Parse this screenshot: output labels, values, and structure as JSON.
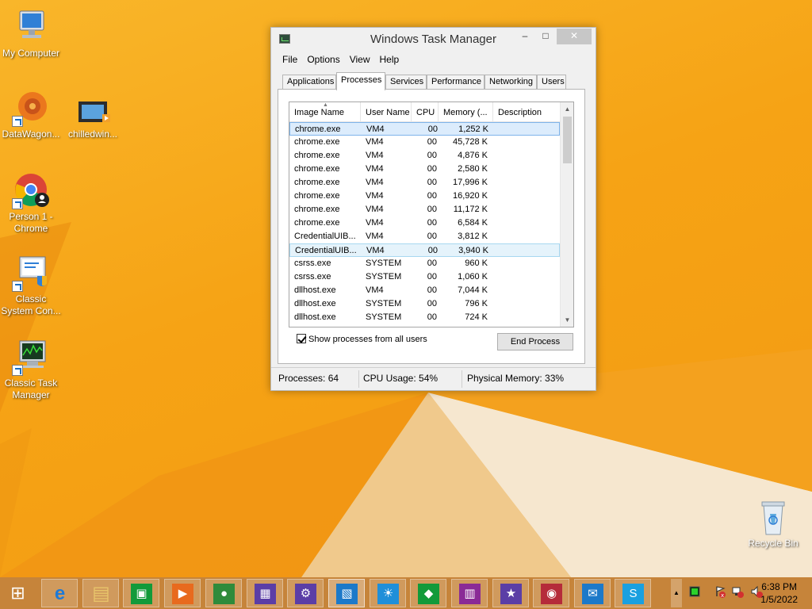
{
  "desktop": {
    "icons": [
      {
        "label": "My Computer",
        "icon": "monitor-icon"
      },
      {
        "label": "DataWagon...",
        "icon": "datawagon-icon"
      },
      {
        "label": "chilledwin...",
        "icon": "video-icon"
      },
      {
        "label": "Person 1 - Chrome",
        "icon": "chrome-icon"
      },
      {
        "label": "Classic System Con...",
        "icon": "control-panel-icon"
      },
      {
        "label": "Classic Task Manager",
        "icon": "task-manager-icon"
      },
      {
        "label": "Recycle Bin",
        "icon": "recycle-bin-icon"
      }
    ]
  },
  "task_manager": {
    "title": "Windows Task Manager",
    "menu": [
      "File",
      "Options",
      "View",
      "Help"
    ],
    "tabs": [
      "Applications",
      "Processes",
      "Services",
      "Performance",
      "Networking",
      "Users"
    ],
    "active_tab": "Processes",
    "columns": [
      "Image Name",
      "User Name",
      "CPU",
      "Memory (...",
      "Description"
    ],
    "processes": [
      {
        "name": "chrome.exe",
        "user": "VM4",
        "cpu": "00",
        "mem": "1,252 K",
        "desc": ""
      },
      {
        "name": "chrome.exe",
        "user": "VM4",
        "cpu": "00",
        "mem": "45,728 K",
        "desc": ""
      },
      {
        "name": "chrome.exe",
        "user": "VM4",
        "cpu": "00",
        "mem": "4,876 K",
        "desc": ""
      },
      {
        "name": "chrome.exe",
        "user": "VM4",
        "cpu": "00",
        "mem": "2,580 K",
        "desc": ""
      },
      {
        "name": "chrome.exe",
        "user": "VM4",
        "cpu": "00",
        "mem": "17,996 K",
        "desc": ""
      },
      {
        "name": "chrome.exe",
        "user": "VM4",
        "cpu": "00",
        "mem": "16,920 K",
        "desc": ""
      },
      {
        "name": "chrome.exe",
        "user": "VM4",
        "cpu": "00",
        "mem": "11,172 K",
        "desc": ""
      },
      {
        "name": "chrome.exe",
        "user": "VM4",
        "cpu": "00",
        "mem": "6,584 K",
        "desc": ""
      },
      {
        "name": "CredentialUIB...",
        "user": "VM4",
        "cpu": "00",
        "mem": "3,812 K",
        "desc": ""
      },
      {
        "name": "CredentialUIB...",
        "user": "VM4",
        "cpu": "00",
        "mem": "3,940 K",
        "desc": ""
      },
      {
        "name": "csrss.exe",
        "user": "SYSTEM",
        "cpu": "00",
        "mem": "960 K",
        "desc": ""
      },
      {
        "name": "csrss.exe",
        "user": "SYSTEM",
        "cpu": "00",
        "mem": "1,060 K",
        "desc": ""
      },
      {
        "name": "dllhost.exe",
        "user": "VM4",
        "cpu": "00",
        "mem": "7,044 K",
        "desc": ""
      },
      {
        "name": "dllhost.exe",
        "user": "SYSTEM",
        "cpu": "00",
        "mem": "796 K",
        "desc": ""
      },
      {
        "name": "dllhost.exe",
        "user": "SYSTEM",
        "cpu": "00",
        "mem": "724 K",
        "desc": ""
      }
    ],
    "selected_row": 0,
    "hover_row": 9,
    "show_all_label": "Show processes from all users",
    "show_all_checked": true,
    "end_process_label": "End Process",
    "status": {
      "processes": "Processes: 64",
      "cpu": "CPU Usage: 54%",
      "memory": "Physical Memory: 33%"
    }
  },
  "taskbar": {
    "buttons": [
      {
        "icon": "start-icon",
        "glyph": "⊞",
        "color": "#c6843a"
      },
      {
        "icon": "internet-explorer-icon",
        "glyph": "e",
        "color": "#1e7ad6"
      },
      {
        "icon": "file-explorer-icon",
        "glyph": "▤",
        "color": "#e8c46a"
      },
      {
        "icon": "store-icon",
        "glyph": "▣",
        "color": "#129a3a"
      },
      {
        "icon": "video-app-icon",
        "glyph": "▶",
        "color": "#e86a1e"
      },
      {
        "icon": "chrome-icon",
        "glyph": "●",
        "color": "#2f8b3b"
      },
      {
        "icon": "calculator-icon",
        "glyph": "▦",
        "color": "#5b3ea6"
      },
      {
        "icon": "settings-icon",
        "glyph": "⚙",
        "color": "#5b3ea6"
      },
      {
        "icon": "remote-desktop-icon",
        "glyph": "▧",
        "color": "#1c79c9"
      },
      {
        "icon": "weather-icon",
        "glyph": "☀",
        "color": "#1f8fd9"
      },
      {
        "icon": "games-icon",
        "glyph": "◆",
        "color": "#129a3a"
      },
      {
        "icon": "maps-icon",
        "glyph": "▥",
        "color": "#8a2a96"
      },
      {
        "icon": "trophy-icon",
        "glyph": "★",
        "color": "#5b3ea6"
      },
      {
        "icon": "camera-icon",
        "glyph": "◉",
        "color": "#b52b3a"
      },
      {
        "icon": "mail-icon",
        "glyph": "✉",
        "color": "#1c79c9"
      },
      {
        "icon": "skype-icon",
        "glyph": "S",
        "color": "#1aa0e0"
      }
    ],
    "clock_time": "6:38 PM",
    "clock_date": "1/5/2022"
  }
}
